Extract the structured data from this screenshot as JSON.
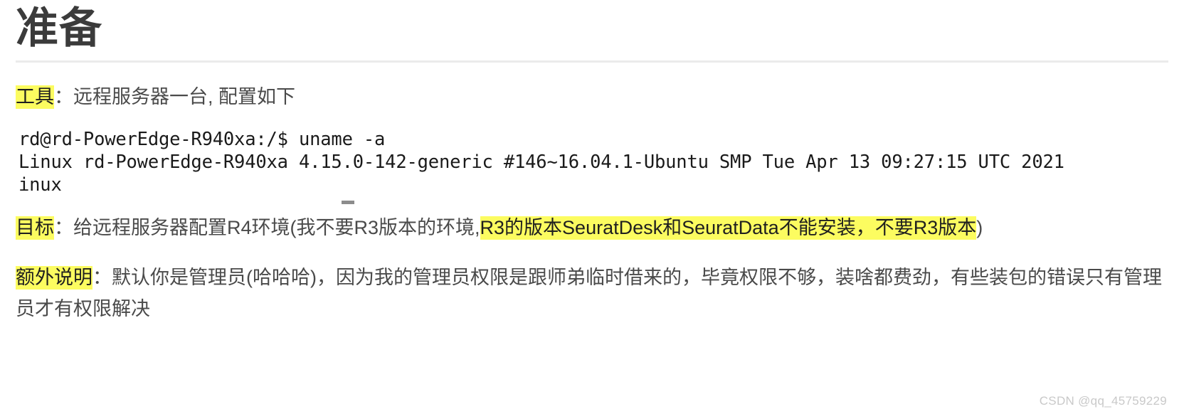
{
  "article": {
    "title": "准备",
    "watermark": "CSDN @qq_45759229"
  },
  "colors": {
    "highlight": "#fcfc60",
    "title_text": "#3b3b3b",
    "body_text": "#4a4a4a",
    "code_text": "#1a1a1a",
    "rule": "#ebebeb",
    "watermark": "#c9c9c9",
    "caret": "#8c8c8c"
  },
  "sections": {
    "tools": {
      "label": "工具",
      "separator": "：",
      "text": "远程服务器一台, 配置如下"
    },
    "code": {
      "lines": [
        "rd@rd-PowerEdge-R940xa:/$ uname -a",
        "Linux rd-PowerEdge-R940xa 4.15.0-142-generic #146~16.04.1-Ubuntu SMP Tue Apr 13 09:27:15 UTC 2021",
        "inux"
      ],
      "line1": "rd@rd-PowerEdge-R940xa:/$ uname -a",
      "line2": "Linux rd-PowerEdge-R940xa 4.15.0-142-generic #146~16.04.1-Ubuntu SMP Tue Apr 13 09:27:15 UTC 2021",
      "line3": "inux"
    },
    "goal": {
      "label": "目标",
      "separator": "：",
      "text_before": "给远程服务器配置R4环境(我不要R3版本的环境,",
      "highlighted": "R3的版本SeuratDesk和SeuratData不能安装，不要R3版本",
      "text_after": ")"
    },
    "extra": {
      "label": "额外说明",
      "separator": "：",
      "text": "默认你是管理员(哈哈哈)，因为我的管理员权限是跟师弟临时借来的，毕竟权限不够，装啥都费劲，有些装包的错误只有管理员才有权限解决"
    }
  }
}
